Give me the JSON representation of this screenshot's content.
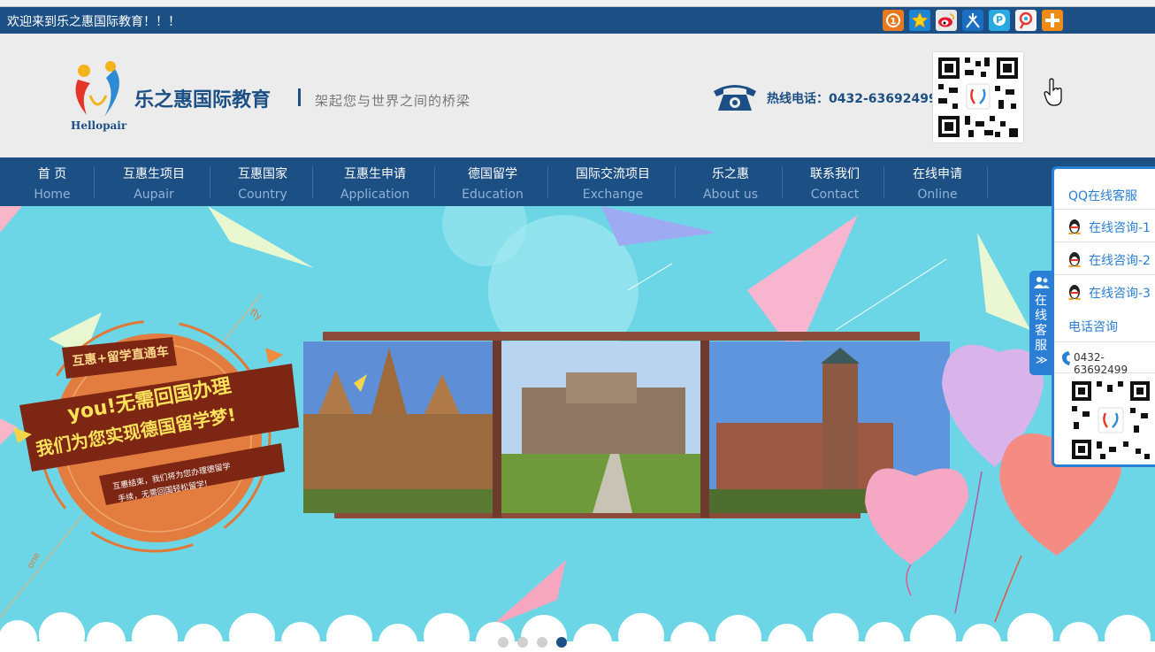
{
  "topbar": {
    "welcome": "欢迎来到乐之惠国际教育！！！",
    "share_icons": [
      "qzone-icon",
      "favorite-star-icon",
      "weibo-icon",
      "renren-icon",
      "kaixin-icon",
      "tencent-weibo-icon",
      "more-share-icon"
    ]
  },
  "header": {
    "logo_text": "Hellopair",
    "brand": "乐之惠国际教育",
    "slogan": "架起您与世界之间的桥梁",
    "hotline": "热线电话：0432-63692499"
  },
  "nav": [
    {
      "cn": "首 页",
      "en": "Home"
    },
    {
      "cn": "互惠生项目",
      "en": "Aupair"
    },
    {
      "cn": "互惠国家",
      "en": "Country"
    },
    {
      "cn": "互惠生申请",
      "en": "Application"
    },
    {
      "cn": "德国留学",
      "en": "Education"
    },
    {
      "cn": "国际交流项目",
      "en": "Exchange"
    },
    {
      "cn": "乐之惠",
      "en": "About us"
    },
    {
      "cn": "联系我们",
      "en": "Contact"
    },
    {
      "cn": "在线申请",
      "en": "Online"
    }
  ],
  "banner": {
    "badge_top": "互惠+留学直通车",
    "headline1": "you!无需回国办理",
    "headline2": "我们为您实现德国留学梦!",
    "subline1": "互惠结束，我们将为您办理德留学",
    "subline2": "手续，无需回国轻松留学!",
    "ring_text1": "fly",
    "ring_text2": "one",
    "active_slide": 4,
    "slide_count": 4
  },
  "side_tab": {
    "label": "在线客服",
    "arrow": "≫"
  },
  "service_panel": {
    "qq_title": "QQ在线客服",
    "consult": [
      "在线咨询-1",
      "在线咨询-2",
      "在线咨询-3"
    ],
    "phone_title": "电话咨询",
    "phone": "0432-63692499"
  },
  "colors": {
    "brand_blue": "#1c4f84",
    "panel_blue": "#2a7fd4",
    "banner_cyan": "#6dd6e6",
    "nav_en": "#8fb3d8"
  }
}
